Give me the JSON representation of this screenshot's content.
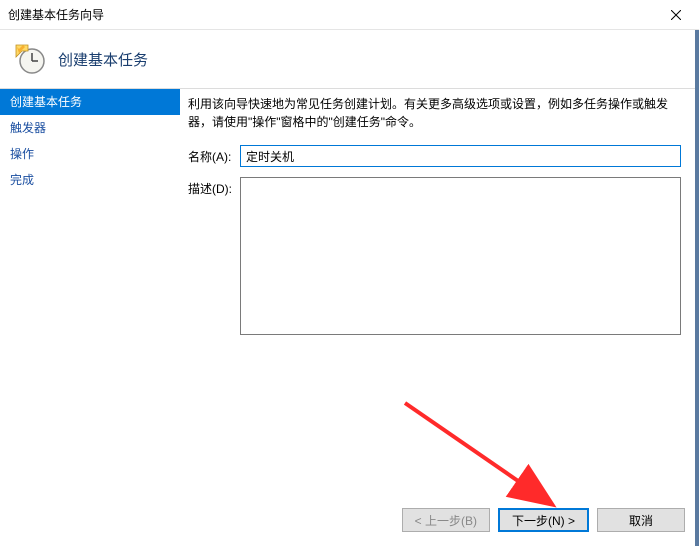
{
  "window": {
    "title": "创建基本任务向导"
  },
  "header": {
    "title": "创建基本任务"
  },
  "sidebar": {
    "items": [
      {
        "label": "创建基本任务",
        "active": true
      },
      {
        "label": "触发器",
        "active": false
      },
      {
        "label": "操作",
        "active": false
      },
      {
        "label": "完成",
        "active": false
      }
    ]
  },
  "main": {
    "intro": "利用该向导快速地为常见任务创建计划。有关更多高级选项或设置，例如多任务操作或触发器，请使用\"操作\"窗格中的\"创建任务\"命令。",
    "name_label": "名称(A):",
    "name_value": "定时关机",
    "desc_label": "描述(D):",
    "desc_value": ""
  },
  "footer": {
    "back": "< 上一步(B)",
    "next": "下一步(N) >",
    "cancel": "取消"
  }
}
